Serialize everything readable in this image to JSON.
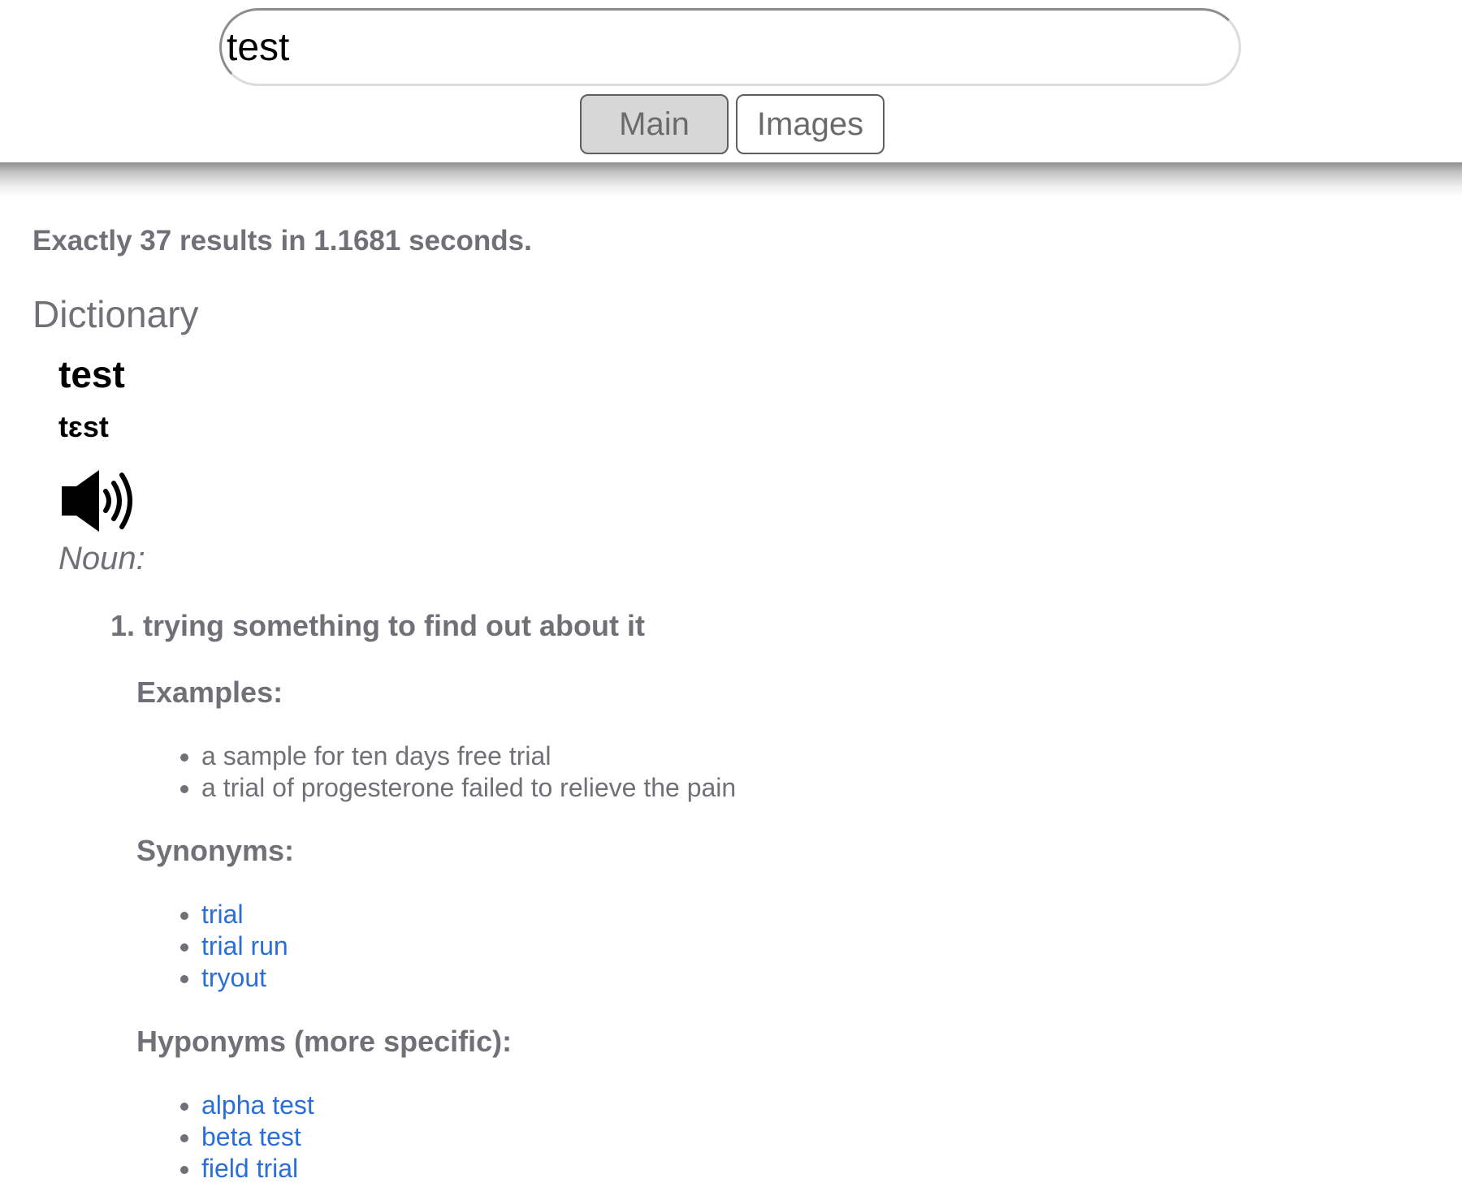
{
  "search": {
    "query": "test"
  },
  "tabs": [
    {
      "label": "Main",
      "active": true
    },
    {
      "label": "Images",
      "active": false
    }
  ],
  "results": {
    "stats": "Exactly 37 results in 1.1681 seconds."
  },
  "dictionary": {
    "section_title": "Dictionary",
    "word": "test",
    "phonetic": "tɛst",
    "audio_icon": "speaker-icon",
    "part_of_speech": "Noun:",
    "definition": "1. trying something to find out about it",
    "examples_heading": "Examples:",
    "examples": [
      "a sample for ten days free trial",
      "a trial of progesterone failed to relieve the pain"
    ],
    "synonyms_heading": "Synonyms:",
    "synonyms": [
      "trial",
      "trial run",
      "tryout"
    ],
    "hyponyms_heading": "Hyponyms (more specific):",
    "hyponyms": [
      "alpha test",
      "beta test",
      "field trial"
    ]
  },
  "colors": {
    "link": "#2a6fd8",
    "muted_text": "#6f7176",
    "active_tab_bg": "#d7d7d7"
  }
}
